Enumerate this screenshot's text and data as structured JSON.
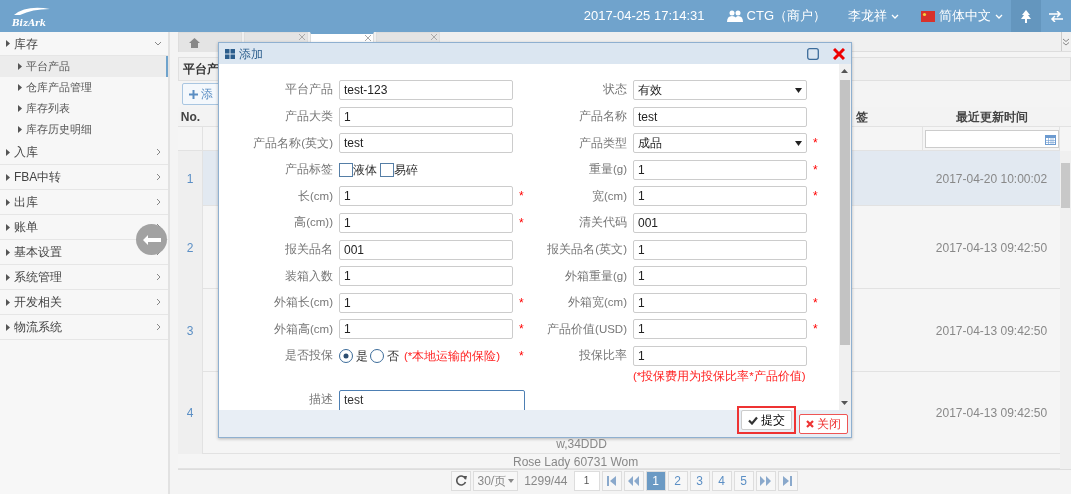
{
  "topbar": {
    "logo": "BizArk",
    "datetime": "2017-04-25 17:14:31",
    "account": "CTG（商户）",
    "user": "李龙祥",
    "language": "简体中文"
  },
  "sidebar": [
    {
      "label": "库存",
      "expanded": true,
      "children": [
        {
          "label": "平台产品",
          "selected": true
        },
        {
          "label": "仓库产品管理",
          "selected": false
        },
        {
          "label": "库存列表",
          "selected": false
        },
        {
          "label": "库存历史明细",
          "selected": false
        }
      ]
    },
    {
      "label": "入库",
      "expanded": false
    },
    {
      "label": "FBA中转",
      "expanded": false
    },
    {
      "label": "出库",
      "expanded": false
    },
    {
      "label": "账单",
      "expanded": false
    },
    {
      "label": "基本设置",
      "expanded": false
    },
    {
      "label": "系统管理",
      "expanded": false
    },
    {
      "label": "开发相关",
      "expanded": false
    },
    {
      "label": "物流系统",
      "expanded": false
    }
  ],
  "tabs": [
    {
      "kind": "home",
      "selected": false
    },
    {
      "kind": "closable",
      "selected": false
    },
    {
      "kind": "closable",
      "selected": true
    },
    {
      "kind": "closable",
      "selected": false
    }
  ],
  "panel": {
    "title": "平台产",
    "add_button": "添"
  },
  "table": {
    "columns": [
      "No.",
      "签",
      "最近更新时间"
    ],
    "rows": [
      {
        "no": "1",
        "selected": true,
        "updated": "2017-04-20 10:00:02"
      },
      {
        "no": "2",
        "selected": false,
        "updated": "2017-04-13 09:42:50"
      },
      {
        "no": "3",
        "selected": false,
        "updated": "2017-04-13 09:42:50"
      },
      {
        "no": "4",
        "selected": false,
        "updated": "2017-04-13 09:42:50",
        "column_5": "w,34DDD"
      },
      {
        "selected": false,
        "column_5": "Rose Lady 60731 Wom"
      }
    ]
  },
  "pagination": {
    "page_size": "30/页",
    "record_info": "1299/44",
    "page_input": "1",
    "pages": [
      {
        "label": "1",
        "selected": true
      },
      {
        "label": "2",
        "selected": false
      },
      {
        "label": "3",
        "selected": false
      },
      {
        "label": "4",
        "selected": false
      },
      {
        "label": "5",
        "selected": false
      }
    ]
  },
  "dialog": {
    "title": "添加",
    "required_mark": "*",
    "rows": [
      [
        {
          "label": "平台产品",
          "kind": "text",
          "value": "test-123",
          "required": false
        },
        {
          "label": "状态",
          "kind": "select",
          "value": "有效",
          "required": false
        }
      ],
      [
        {
          "label": "产品大类",
          "kind": "text",
          "value": "1",
          "required": false
        },
        {
          "label": "产品名称",
          "kind": "text",
          "value": "test",
          "required": false
        }
      ],
      [
        {
          "label": "产品名称(英文)",
          "kind": "text",
          "value": "test",
          "required": false
        },
        {
          "label": "产品类型",
          "kind": "select",
          "value": "成品",
          "required": true
        }
      ],
      [
        {
          "label": "产品标签",
          "kind": "checkboxes",
          "options": [
            {
              "label": "液体",
              "checked": false
            },
            {
              "label": "易碎",
              "checked": false
            }
          ],
          "required": false
        },
        {
          "label": "重量(g)",
          "kind": "text",
          "value": "1",
          "required": true
        }
      ],
      [
        {
          "label": "长(cm)",
          "kind": "text",
          "value": "1",
          "required": true
        },
        {
          "label": "宽(cm)",
          "kind": "text",
          "value": "1",
          "required": true
        }
      ],
      [
        {
          "label": "高(cm))",
          "kind": "text",
          "value": "1",
          "required": true
        },
        {
          "label": "清关代码",
          "kind": "text",
          "value": "001",
          "required": false
        }
      ],
      [
        {
          "label": "报关品名",
          "kind": "text",
          "value": "001",
          "required": false
        },
        {
          "label": "报关品名(英文)",
          "kind": "text",
          "value": "1",
          "required": false
        }
      ],
      [
        {
          "label": "装箱入数",
          "kind": "text",
          "value": "1",
          "required": false
        },
        {
          "label": "外箱重量(g)",
          "kind": "text",
          "value": "1",
          "required": false
        }
      ],
      [
        {
          "label": "外箱长(cm)",
          "kind": "text",
          "value": "1",
          "required": true
        },
        {
          "label": "外箱宽(cm)",
          "kind": "text",
          "value": "1",
          "required": true
        }
      ],
      [
        {
          "label": "外箱高(cm)",
          "kind": "text",
          "value": "1",
          "required": true
        },
        {
          "label": "产品价值(USD)",
          "kind": "text",
          "value": "1",
          "required": true
        }
      ],
      [
        {
          "label": "是否投保",
          "kind": "radios",
          "options": [
            {
              "label": "是",
              "selected": true
            },
            {
              "label": "否",
              "selected": false
            }
          ],
          "note": "(*本地运输的保险)",
          "required": true
        },
        {
          "label": "投保比率",
          "kind": "text",
          "value": "1",
          "required": false,
          "note": "(*投保费用为投保比率*产品价值)"
        }
      ],
      [
        {
          "label": "描述",
          "kind": "textarea",
          "value": "test",
          "required": false
        }
      ]
    ],
    "buttons": [
      {
        "label": "提交",
        "kind": "submit",
        "highlighted": true
      },
      {
        "label": "关闭",
        "kind": "close",
        "highlighted": false
      }
    ]
  }
}
